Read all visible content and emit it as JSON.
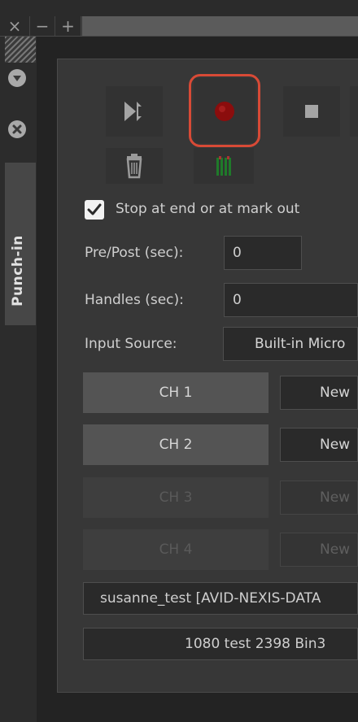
{
  "window": {
    "controls": [
      {
        "name": "close",
        "glyph": "×"
      },
      {
        "name": "minimize",
        "glyph": "−"
      },
      {
        "name": "maximize",
        "glyph": "+"
      }
    ]
  },
  "sidebar": {
    "tab_label": "Punch-in",
    "icons": [
      "menu-dropdown-icon",
      "close-circle-icon"
    ]
  },
  "toolbar": {
    "icons": [
      "play-to-end-icon",
      "record-icon",
      "stop-icon",
      "trash-icon",
      "audio-meter-icon"
    ],
    "record_highlight_color": "#d84a36",
    "record_color": "#8b0d0d"
  },
  "options": {
    "stop_at_end_label": "Stop at end or at mark out",
    "stop_at_end_checked": true
  },
  "fields": {
    "prepost_label": "Pre/Post (sec):",
    "prepost_value": "0",
    "handles_label": "Handles (sec):",
    "handles_value": "0",
    "input_source_label": "Input Source:",
    "input_source_value": "Built-in Micro"
  },
  "channels": [
    {
      "label": "CH 1",
      "track": "New",
      "enabled": true
    },
    {
      "label": "CH 2",
      "track": "New",
      "enabled": true
    },
    {
      "label": "CH 3",
      "track": "New",
      "enabled": false
    },
    {
      "label": "CH 4",
      "track": "New",
      "enabled": false
    }
  ],
  "destination": {
    "workspace": "susanne_test [AVID-NEXIS-DATA",
    "bin": "1080 test 2398 Bin3"
  }
}
